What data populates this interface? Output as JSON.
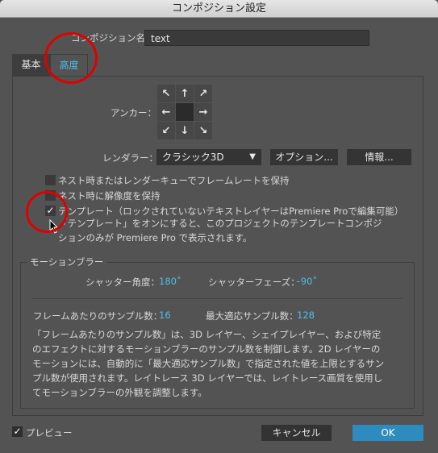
{
  "window": {
    "title": "コンポジション設定"
  },
  "composition_name": {
    "label": "コンポジション名：",
    "value": "text"
  },
  "tabs": [
    {
      "label": "基本",
      "active": false
    },
    {
      "label": "高度",
      "active": true
    }
  ],
  "anchor": {
    "label": "アンカー：",
    "cells": [
      "arrow-up-left",
      "arrow-up",
      "arrow-up-right",
      "arrow-left",
      "center",
      "arrow-right",
      "arrow-down-left",
      "arrow-down",
      "arrow-down-right"
    ],
    "glyphs": [
      "↖",
      "↑",
      "↗",
      "←",
      "",
      "→",
      "↙",
      "↓",
      "↘"
    ],
    "selected": "center"
  },
  "renderer": {
    "label": "レンダラー：",
    "selected": "クラシック3D",
    "options_button": "オプション...",
    "info_button": "情報..."
  },
  "checkboxes": [
    {
      "label": "ネスト時またはレンダーキューでフレームレートを保持",
      "checked": false
    },
    {
      "label": "ネスト時に解像度を保持",
      "checked": false
    },
    {
      "label": "テンプレート（ロックされていないテキストレイヤーはPremiere Proで編集可能）",
      "checked": true
    }
  ],
  "template_note": {
    "line1": "「テンプレート」をオンにすると、このプロジェクトのテンプレートコンポジ",
    "line2": "ションのみが Premiere Pro で表示されます。"
  },
  "motion_blur": {
    "legend": "モーションブラー",
    "shutter_angle_label": "シャッター角度：",
    "shutter_angle_value": "180˚",
    "shutter_phase_label": "シャッターフェーズ：",
    "shutter_phase_value": "–90˚",
    "samples_per_frame_label": "フレームあたりのサンプル数：",
    "samples_per_frame_value": "16",
    "adaptive_sample_limit_label": "最大適応サンプル数：",
    "adaptive_sample_limit_value": "128",
    "description": [
      "「フレームあたりのサンプル数」は、3D レイヤー、シェイプレイヤー、および特定",
      "のエフェクトに対するモーションブラーのサンプル数を制御します。2D レイヤーの",
      "モーションには、自動的に「最大適応サンプル数」で指定された値を上限とするサン",
      "プル数が使用されます。レイトレース 3D レイヤーでは、レイトレース画質を使用し",
      "てモーションブラーの外観を調整します。"
    ]
  },
  "footer": {
    "preview_label": "プレビュー",
    "preview_checked": true,
    "cancel_button": "キャンセル",
    "ok_button": "OK"
  },
  "checkmark": "✓",
  "caret": "▼",
  "colors": {
    "accent": "#4fbde8",
    "ok_button": "#2d8bbd",
    "annotation": "#e00000"
  }
}
